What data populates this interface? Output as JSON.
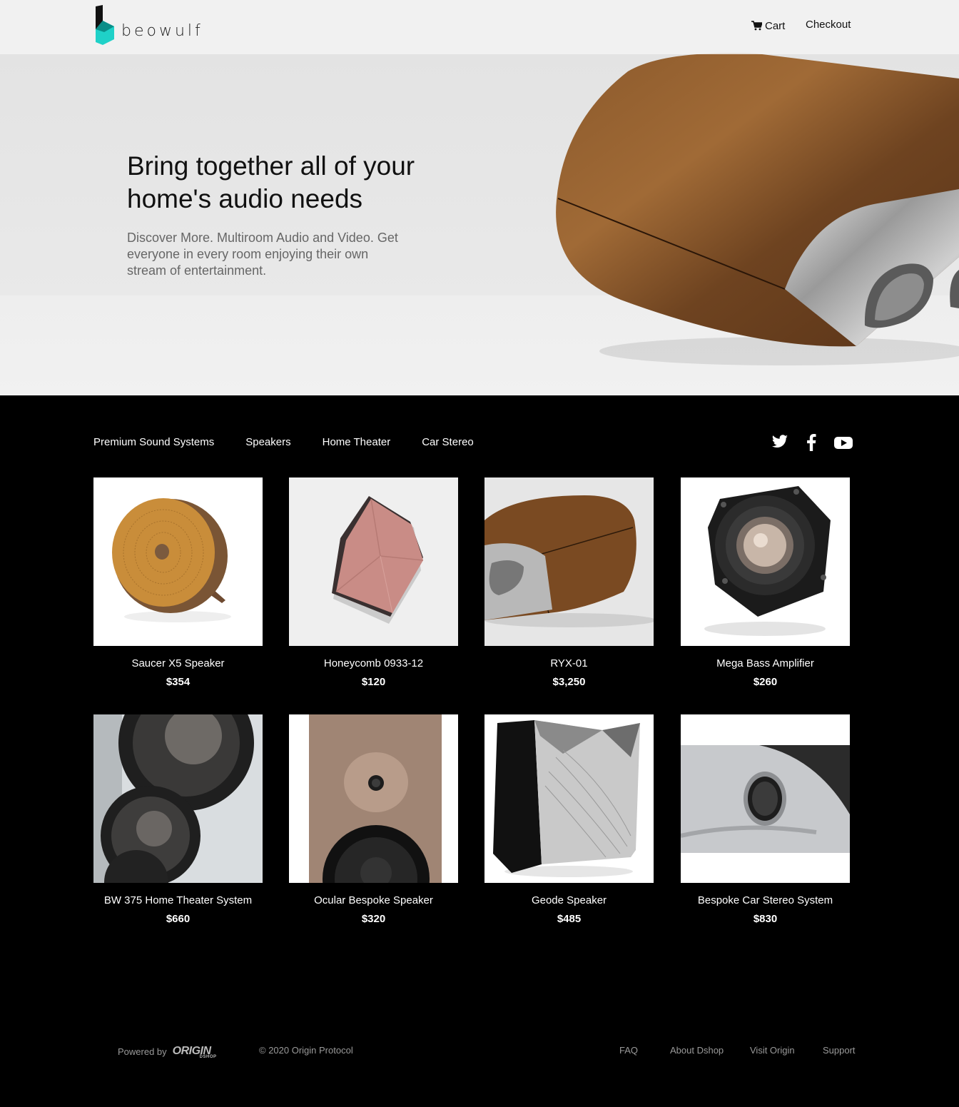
{
  "header": {
    "brand": "beowulf",
    "cart_label": "Cart",
    "checkout_label": "Checkout"
  },
  "hero": {
    "title": "Bring together all of your home's audio needs",
    "subtitle": "Discover More. Multiroom Audio and Video. Get everyone in every room enjoying their own stream of entertainment."
  },
  "categories": [
    "Premium Sound Systems",
    "Speakers",
    "Home Theater",
    "Car Stereo"
  ],
  "social": [
    "twitter-icon",
    "facebook-icon",
    "youtube-icon"
  ],
  "products": [
    {
      "name": "Saucer X5 Speaker",
      "price": "$354"
    },
    {
      "name": "Honeycomb 0933-12",
      "price": "$120"
    },
    {
      "name": "RYX-01",
      "price": "$3,250"
    },
    {
      "name": "Mega Bass Amplifier",
      "price": "$260"
    },
    {
      "name": "BW 375 Home Theater System",
      "price": "$660"
    },
    {
      "name": "Ocular Bespoke Speaker",
      "price": "$320"
    },
    {
      "name": "Geode Speaker",
      "price": "$485"
    },
    {
      "name": "Bespoke Car Stereo System",
      "price": "$830"
    }
  ],
  "footer": {
    "powered_by": "Powered by",
    "origin_logo": "ORIGIN",
    "origin_sub": "DSHOP",
    "copyright": "© 2020 Origin Protocol",
    "links": [
      "FAQ",
      "About Dshop",
      "Visit Origin",
      "Support"
    ]
  },
  "colors": {
    "brand_accent": "#1fd1c8",
    "page_background": "#000000",
    "hero_background": "#e6e6e6"
  }
}
